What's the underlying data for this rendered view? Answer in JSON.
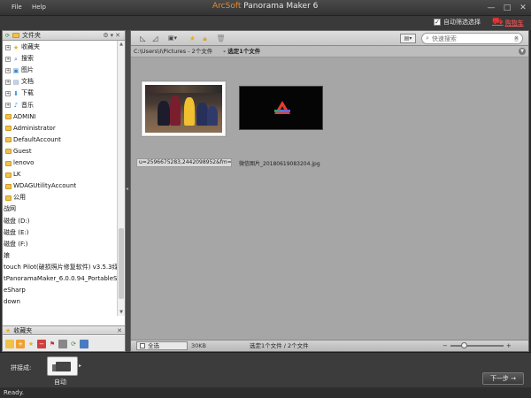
{
  "menu": {
    "file": "File",
    "help": "Help"
  },
  "app": {
    "brand": "ArcSoft",
    "title": "Panorama Maker 6"
  },
  "window": {
    "minimize": "—",
    "maximize": "□",
    "close": "✕"
  },
  "topstrip": {
    "autoselect_label": "自动筛选选择",
    "autoselect_checked": true,
    "cart_label": "购物车"
  },
  "leftpanel": {
    "header": "文件夹",
    "tree": [
      {
        "label": "收藏夹",
        "expand": true,
        "icon": "star-icon",
        "glyph": "★",
        "color": "#e8b020"
      },
      {
        "label": "搜索",
        "expand": true,
        "icon": "search-icon",
        "glyph": "⌕",
        "color": "#3a6fc8"
      },
      {
        "label": "图片",
        "expand": true,
        "icon": "picture-icon",
        "glyph": "▣",
        "color": "#3a86c8"
      },
      {
        "label": "文档",
        "expand": true,
        "icon": "document-icon",
        "glyph": "▤",
        "color": "#6a8ac0"
      },
      {
        "label": "下载",
        "expand": true,
        "icon": "download-icon",
        "glyph": "⬇",
        "color": "#2e8ae0"
      },
      {
        "label": "音乐",
        "expand": true,
        "icon": "music-icon",
        "glyph": "♪",
        "color": "#2e8ae0"
      },
      {
        "label": "ADMINI",
        "folder": true
      },
      {
        "label": "Administrator",
        "folder": true
      },
      {
        "label": "DefaultAccount",
        "folder": true
      },
      {
        "label": "Guest",
        "folder": true
      },
      {
        "label": "lenovo",
        "folder": true
      },
      {
        "label": "LK",
        "folder": true
      },
      {
        "label": "WDAGUtilityAccount",
        "folder": true
      },
      {
        "label": "公用",
        "folder": true
      },
      {
        "label": "战网"
      },
      {
        "label": "磁盘 (D:)"
      },
      {
        "label": "磁盘 (E:)"
      },
      {
        "label": "磁盘 (F:)"
      },
      {
        "label": "娘"
      },
      {
        "label": "touch Pilot(破损照片修复软件) v3.5.3绿"
      },
      {
        "label": "tPanoramaMaker_6.0.0.94_PortableSo"
      },
      {
        "label": "eSharp"
      },
      {
        "label": "down"
      }
    ],
    "favorites_header": "收藏夹"
  },
  "toolbar": {
    "search_placeholder": "快速搜索"
  },
  "path": {
    "text": "C:\\Users\\I\\Pictures - 2个文件",
    "selected": "- 选定1个文件"
  },
  "files": [
    {
      "caption": "u=2596675283,2442098952&fm=..."
    },
    {
      "caption": "微信图片_20180619083204.jpg"
    }
  ],
  "status": {
    "select_all": "全选",
    "size": "30KB",
    "count": "选定1个文件 / 2个文件",
    "zoom_minus": "−",
    "zoom_plus": "+",
    "zoom_level": 0.25
  },
  "bottom": {
    "stitch_label": "拼接成:",
    "stitch_mode": "自动",
    "next": "下一步"
  },
  "statusline": "Ready."
}
